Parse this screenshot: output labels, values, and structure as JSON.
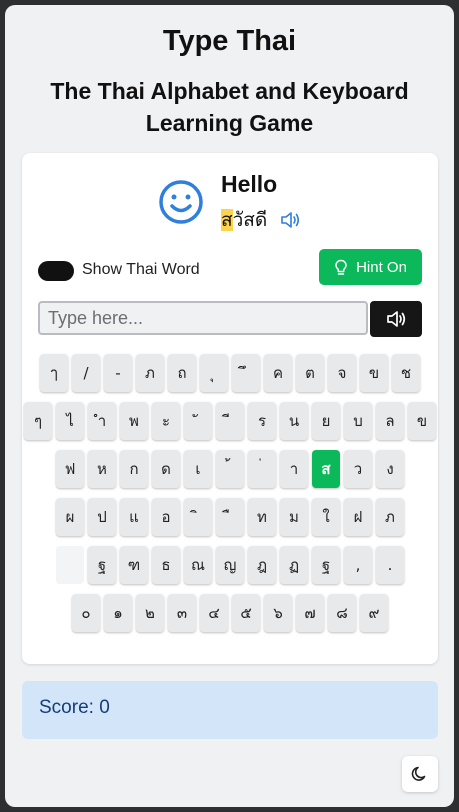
{
  "app": {
    "title": "Type Thai",
    "subtitle": "The Thai Alphabet and Keyboard Learning Game"
  },
  "word": {
    "english": "Hello",
    "thai_highlight": "ส",
    "thai_rest": "วัสดี",
    "icon": "smiley-face-icon"
  },
  "toggle": {
    "label": "Show Thai Word",
    "on": false
  },
  "hint_button": {
    "label": "Hint On",
    "icon": "lightbulb-icon"
  },
  "input": {
    "placeholder": "Type here...",
    "value": ""
  },
  "keyboard": {
    "active_key": "ส",
    "rows": [
      [
        "ๅ",
        "/",
        "-",
        "ภ",
        "ถ",
        "ุ",
        "ึ",
        "ค",
        "ต",
        "จ",
        "ข",
        "ช"
      ],
      [
        "ๆ",
        "ไ",
        "ำ",
        "พ",
        "ะ",
        "ั",
        "ี",
        "ร",
        "น",
        "ย",
        "บ",
        "ล",
        "ข"
      ],
      [
        "ฟ",
        "ห",
        "ก",
        "ด",
        "เ",
        "้",
        "่",
        "า",
        "ส",
        "ว",
        "ง"
      ],
      [
        "ผ",
        "ป",
        "แ",
        "อ",
        "ิ",
        "ื",
        "ท",
        "ม",
        "ใ",
        "ฝ",
        "ภ"
      ],
      [
        "",
        "ฐ",
        "ฑ",
        "ธ",
        "ณ",
        "ญ",
        "ฎ",
        "ฏ",
        "ฐ",
        ",",
        "."
      ],
      [
        "๐",
        "๑",
        "๒",
        "๓",
        "๔",
        "๕",
        "๖",
        "๗",
        "๘",
        "๙"
      ]
    ]
  },
  "score": {
    "label": "Score: 0"
  },
  "colors": {
    "accent_green": "#0bb85a",
    "highlight": "#fcd34d",
    "blue_icon": "#2f7fdc",
    "score_bg": "#d3e5f9"
  },
  "theme_button": {
    "icon": "moon-icon"
  }
}
